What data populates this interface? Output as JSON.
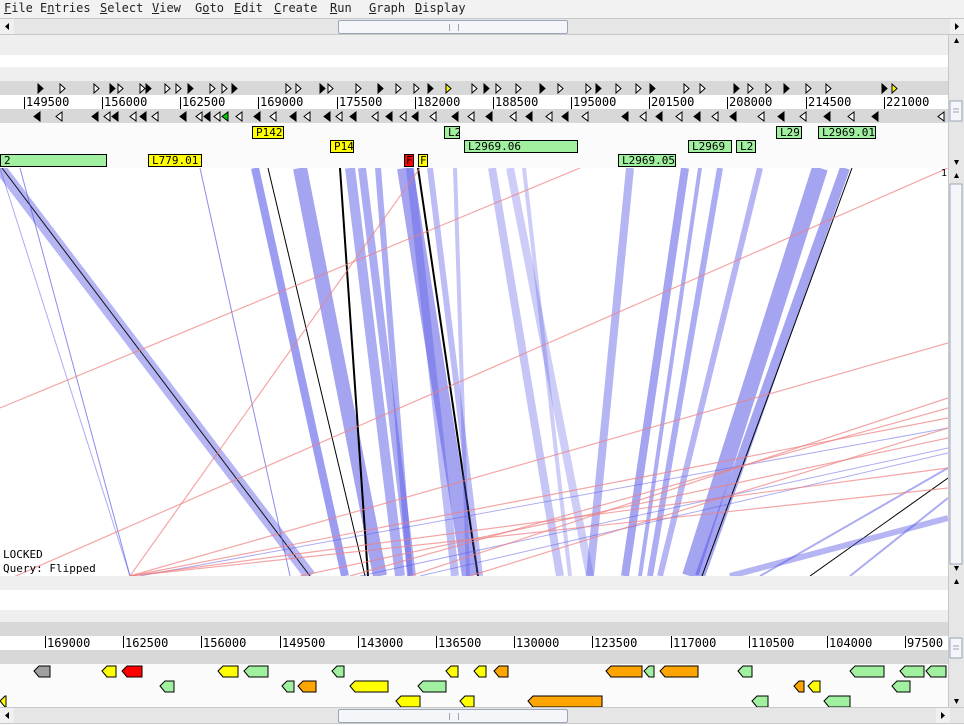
{
  "menu": {
    "items": [
      {
        "label": "File",
        "u": "F"
      },
      {
        "label": "Entries",
        "u": "n"
      },
      {
        "label": "Select",
        "u": "S"
      },
      {
        "label": "View",
        "u": "V"
      },
      {
        "label": "Goto",
        "u": "o"
      },
      {
        "label": "Edit",
        "u": "E"
      },
      {
        "label": "Create",
        "u": "C"
      },
      {
        "label": "Run",
        "u": "R"
      },
      {
        "label": "Graph",
        "u": "G"
      },
      {
        "label": "Display",
        "u": "D"
      }
    ]
  },
  "top_ruler": {
    "labels": [
      "149500",
      "156000",
      "162500",
      "169000",
      "175500",
      "182000",
      "188500",
      "195000",
      "201500",
      "208000",
      "214500",
      "221000"
    ]
  },
  "top_features": {
    "row1": [
      {
        "label": "P142",
        "color": "#ffff00"
      },
      {
        "label": "L2",
        "color": "#a0f0a0"
      },
      {
        "label": "L29",
        "color": "#a0f0a0"
      },
      {
        "label": "L2969.01",
        "color": "#a0f0a0"
      }
    ],
    "row2": [
      {
        "label": "P14",
        "color": "#ffff00"
      },
      {
        "label": "L2969.06",
        "color": "#a0f0a0"
      },
      {
        "label": "L2969",
        "color": "#a0f0a0"
      },
      {
        "label": "L2",
        "color": "#a0f0a0"
      }
    ],
    "row3": [
      {
        "label": "2",
        "color": "#a0f0a0"
      },
      {
        "label": "L779.01",
        "color": "#ffff00"
      },
      {
        "label": "F",
        "color": "#ff0000"
      },
      {
        "label": "F",
        "color": "#ffff00"
      },
      {
        "label": "L2969.05",
        "color": "#a0f0a0"
      }
    ]
  },
  "comparison": {
    "status_locked": "LOCKED",
    "status_query": "Query: Flipped",
    "corner_value": "1",
    "colors": {
      "forward": "#5a5ae6",
      "reverse": "#f08080",
      "match_black": "#000000"
    }
  },
  "bottom_ruler": {
    "labels": [
      "169000",
      "162500",
      "156000",
      "149500",
      "143000",
      "136500",
      "130000",
      "123500",
      "117000",
      "110500",
      "104000",
      "97500"
    ]
  },
  "bottom_features": {
    "colors": [
      "#a0a0a0",
      "#ffff00",
      "#ff0000",
      "#a0f0a0",
      "#ffa500"
    ]
  },
  "icons": {
    "left_arrow": "left-arrow-icon",
    "right_arrow": "right-arrow-icon",
    "up_arrow": "up-arrow-icon",
    "down_arrow": "down-arrow-icon"
  }
}
